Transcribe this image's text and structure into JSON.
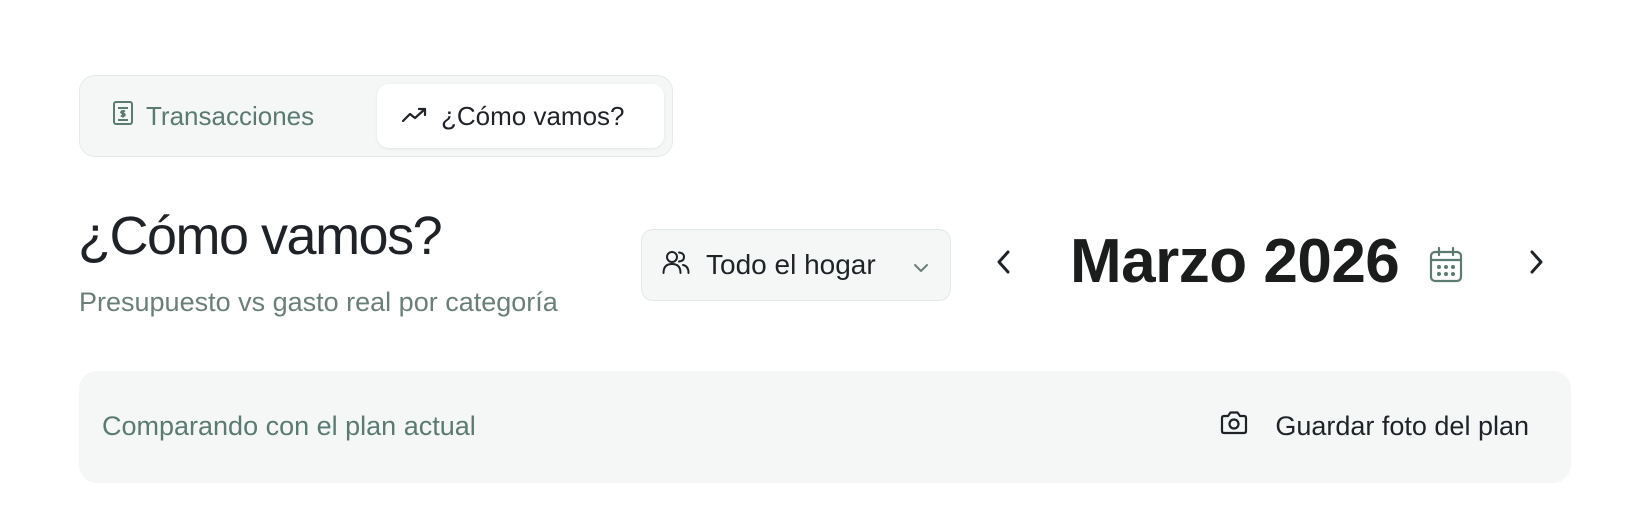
{
  "tabs": {
    "transactions": {
      "label": "Transacciones",
      "icon": "receipt-icon"
    },
    "como_vamos": {
      "label": "¿Cómo vamos?",
      "icon": "trending-up-icon",
      "active": true
    }
  },
  "header": {
    "title": "¿Cómo vamos?",
    "subtitle": "Presupuesto vs gasto real por categoría"
  },
  "scope": {
    "selected": "Todo el hogar",
    "icon": "users-icon"
  },
  "period": {
    "month_label": "Marzo 2026",
    "prev_icon": "chevron-left-icon",
    "next_icon": "chevron-right-icon",
    "calendar_icon": "calendar-icon"
  },
  "plan": {
    "status_text": "Comparando con el plan actual",
    "save_label": "Guardar foto del plan",
    "save_icon": "camera-icon"
  },
  "colors": {
    "accent_muted": "#5b7a72",
    "panel_bg": "#f4f7f6",
    "text": "#1f2328"
  }
}
